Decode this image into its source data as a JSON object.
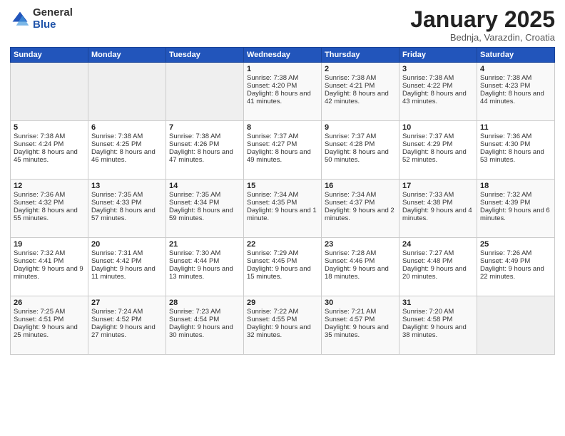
{
  "logo": {
    "general": "General",
    "blue": "Blue"
  },
  "header": {
    "title": "January 2025",
    "subtitle": "Bednja, Varazdin, Croatia"
  },
  "days_of_week": [
    "Sunday",
    "Monday",
    "Tuesday",
    "Wednesday",
    "Thursday",
    "Friday",
    "Saturday"
  ],
  "weeks": [
    [
      {
        "day": "",
        "empty": true
      },
      {
        "day": "",
        "empty": true
      },
      {
        "day": "",
        "empty": true
      },
      {
        "day": "1",
        "sunrise": "7:38 AM",
        "sunset": "4:20 PM",
        "daylight": "8 hours and 41 minutes."
      },
      {
        "day": "2",
        "sunrise": "7:38 AM",
        "sunset": "4:21 PM",
        "daylight": "8 hours and 42 minutes."
      },
      {
        "day": "3",
        "sunrise": "7:38 AM",
        "sunset": "4:22 PM",
        "daylight": "8 hours and 43 minutes."
      },
      {
        "day": "4",
        "sunrise": "7:38 AM",
        "sunset": "4:23 PM",
        "daylight": "8 hours and 44 minutes."
      }
    ],
    [
      {
        "day": "5",
        "sunrise": "7:38 AM",
        "sunset": "4:24 PM",
        "daylight": "8 hours and 45 minutes."
      },
      {
        "day": "6",
        "sunrise": "7:38 AM",
        "sunset": "4:25 PM",
        "daylight": "8 hours and 46 minutes."
      },
      {
        "day": "7",
        "sunrise": "7:38 AM",
        "sunset": "4:26 PM",
        "daylight": "8 hours and 47 minutes."
      },
      {
        "day": "8",
        "sunrise": "7:37 AM",
        "sunset": "4:27 PM",
        "daylight": "8 hours and 49 minutes."
      },
      {
        "day": "9",
        "sunrise": "7:37 AM",
        "sunset": "4:28 PM",
        "daylight": "8 hours and 50 minutes."
      },
      {
        "day": "10",
        "sunrise": "7:37 AM",
        "sunset": "4:29 PM",
        "daylight": "8 hours and 52 minutes."
      },
      {
        "day": "11",
        "sunrise": "7:36 AM",
        "sunset": "4:30 PM",
        "daylight": "8 hours and 53 minutes."
      }
    ],
    [
      {
        "day": "12",
        "sunrise": "7:36 AM",
        "sunset": "4:32 PM",
        "daylight": "8 hours and 55 minutes."
      },
      {
        "day": "13",
        "sunrise": "7:35 AM",
        "sunset": "4:33 PM",
        "daylight": "8 hours and 57 minutes."
      },
      {
        "day": "14",
        "sunrise": "7:35 AM",
        "sunset": "4:34 PM",
        "daylight": "8 hours and 59 minutes."
      },
      {
        "day": "15",
        "sunrise": "7:34 AM",
        "sunset": "4:35 PM",
        "daylight": "9 hours and 1 minute."
      },
      {
        "day": "16",
        "sunrise": "7:34 AM",
        "sunset": "4:37 PM",
        "daylight": "9 hours and 2 minutes."
      },
      {
        "day": "17",
        "sunrise": "7:33 AM",
        "sunset": "4:38 PM",
        "daylight": "9 hours and 4 minutes."
      },
      {
        "day": "18",
        "sunrise": "7:32 AM",
        "sunset": "4:39 PM",
        "daylight": "9 hours and 6 minutes."
      }
    ],
    [
      {
        "day": "19",
        "sunrise": "7:32 AM",
        "sunset": "4:41 PM",
        "daylight": "9 hours and 9 minutes."
      },
      {
        "day": "20",
        "sunrise": "7:31 AM",
        "sunset": "4:42 PM",
        "daylight": "9 hours and 11 minutes."
      },
      {
        "day": "21",
        "sunrise": "7:30 AM",
        "sunset": "4:44 PM",
        "daylight": "9 hours and 13 minutes."
      },
      {
        "day": "22",
        "sunrise": "7:29 AM",
        "sunset": "4:45 PM",
        "daylight": "9 hours and 15 minutes."
      },
      {
        "day": "23",
        "sunrise": "7:28 AM",
        "sunset": "4:46 PM",
        "daylight": "9 hours and 18 minutes."
      },
      {
        "day": "24",
        "sunrise": "7:27 AM",
        "sunset": "4:48 PM",
        "daylight": "9 hours and 20 minutes."
      },
      {
        "day": "25",
        "sunrise": "7:26 AM",
        "sunset": "4:49 PM",
        "daylight": "9 hours and 22 minutes."
      }
    ],
    [
      {
        "day": "26",
        "sunrise": "7:25 AM",
        "sunset": "4:51 PM",
        "daylight": "9 hours and 25 minutes."
      },
      {
        "day": "27",
        "sunrise": "7:24 AM",
        "sunset": "4:52 PM",
        "daylight": "9 hours and 27 minutes."
      },
      {
        "day": "28",
        "sunrise": "7:23 AM",
        "sunset": "4:54 PM",
        "daylight": "9 hours and 30 minutes."
      },
      {
        "day": "29",
        "sunrise": "7:22 AM",
        "sunset": "4:55 PM",
        "daylight": "9 hours and 32 minutes."
      },
      {
        "day": "30",
        "sunrise": "7:21 AM",
        "sunset": "4:57 PM",
        "daylight": "9 hours and 35 minutes."
      },
      {
        "day": "31",
        "sunrise": "7:20 AM",
        "sunset": "4:58 PM",
        "daylight": "9 hours and 38 minutes."
      },
      {
        "day": "",
        "empty": true
      }
    ]
  ],
  "cell_labels": {
    "sunrise": "Sunrise: ",
    "sunset": "Sunset: ",
    "daylight": "Daylight: "
  }
}
